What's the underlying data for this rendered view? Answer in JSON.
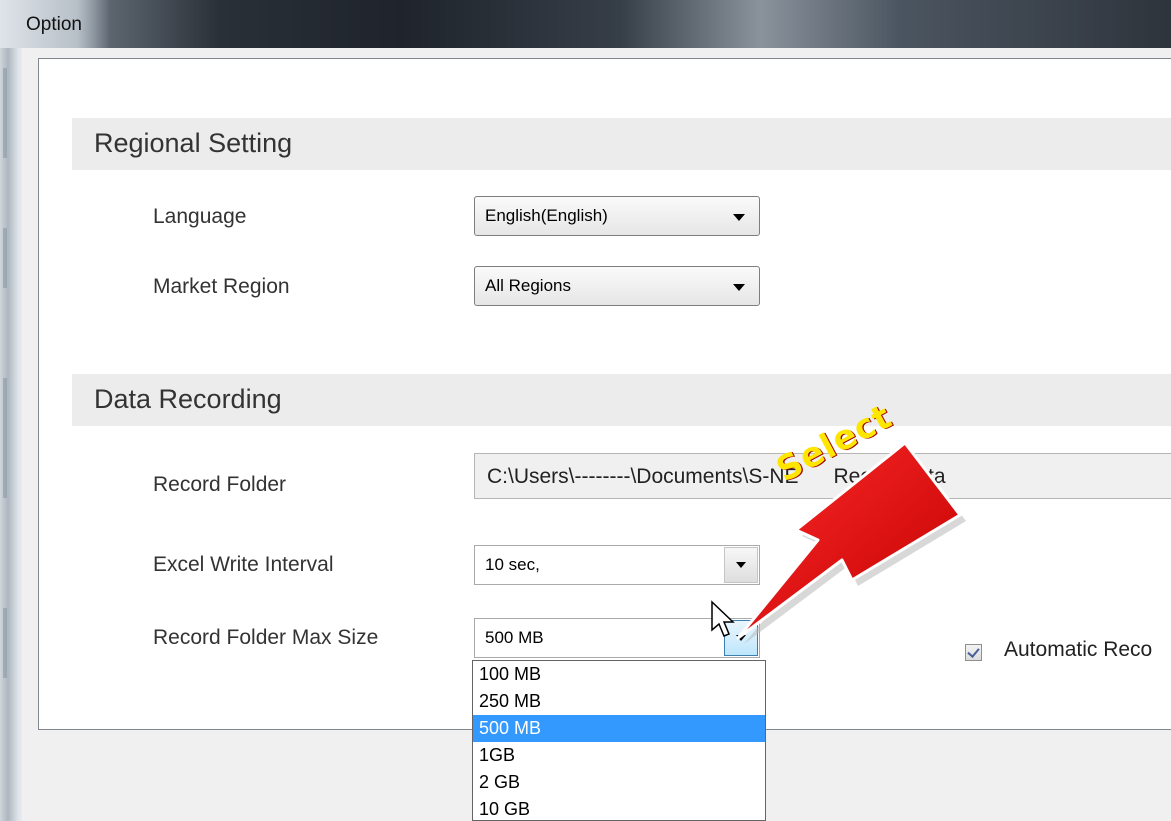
{
  "window": {
    "title": "Option"
  },
  "regional": {
    "heading": "Regional Setting",
    "language_label": "Language",
    "language_value": "English(English)",
    "market_label": "Market Region",
    "market_value": "All Regions"
  },
  "recording": {
    "heading": "Data Recording",
    "folder_label": "Record Folder",
    "folder_value": "C:\\Users\\--------\\Documents\\S-NE      RecordData",
    "interval_label": "Excel Write Interval",
    "interval_value": "10 sec,",
    "maxsize_label": "Record Folder Max Size",
    "maxsize_value": "500 MB",
    "maxsize_options": [
      "100 MB",
      "250 MB",
      "500 MB",
      "1GB",
      "2 GB",
      "10 GB"
    ],
    "maxsize_selected_index": 2,
    "auto_checked": true,
    "auto_label": "Automatic Reco"
  },
  "annotation": {
    "text": "Select",
    "color": "#e00000"
  },
  "colors": {
    "selection": "#3399ff",
    "section_bg": "#ececec"
  }
}
